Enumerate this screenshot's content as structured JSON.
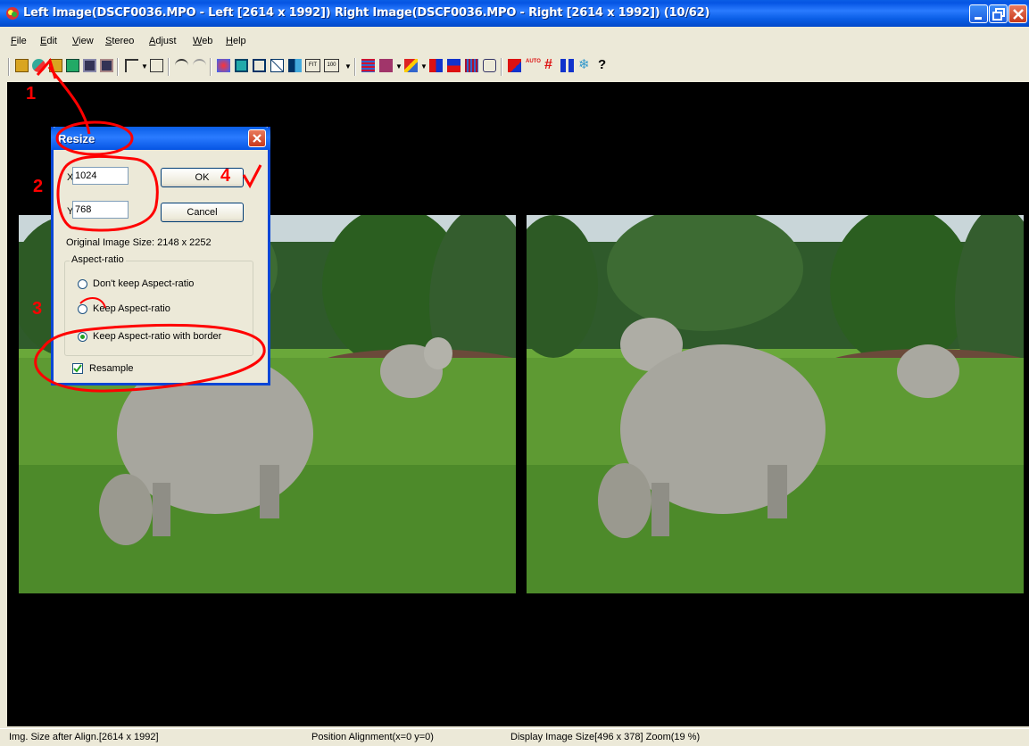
{
  "window": {
    "title": "Left Image(DSCF0036.MPO - Left [2614 x 1992]) Right Image(DSCF0036.MPO - Right [2614 x 1992])  (10/62)"
  },
  "menu": [
    "File",
    "Edit",
    "View",
    "Stereo",
    "Adjust",
    "Web",
    "Help"
  ],
  "dialog": {
    "title": "Resize",
    "x_label": "X:",
    "x_value": "1024",
    "y_label": "Y:",
    "y_value": "768",
    "ok_label": "OK",
    "cancel_label": "Cancel",
    "original_size": "Original Image Size: 2148 x 2252",
    "group_label": "Aspect-ratio",
    "options": [
      "Don't keep Aspect-ratio",
      "Keep Aspect-ratio",
      "Keep Aspect-ratio with border"
    ],
    "selected_option": 2,
    "resample_label": "Resample",
    "resample_checked": true
  },
  "annotations": [
    "1",
    "2",
    "3",
    "4"
  ],
  "status": {
    "size_after_align": "Img. Size after Align.[2614 x 1992]",
    "position_alignment": "Position Alignment(x=0 y=0)",
    "display_size": "Display Image Size[496 x 378]  Zoom(19 %)"
  },
  "colors": {
    "annotation": "#ff0000",
    "titlebar": "#0a5ee6",
    "viewer_bg": "#000000"
  }
}
